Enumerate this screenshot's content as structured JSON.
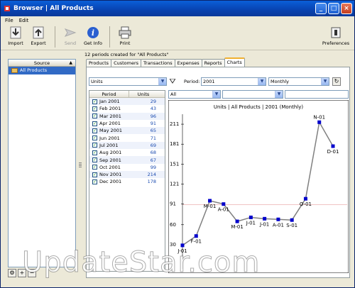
{
  "window": {
    "title": "Browser | All Products"
  },
  "menu": [
    "File",
    "Edit"
  ],
  "toolbar": {
    "import": "Import",
    "export": "Export",
    "send": "Send",
    "get_info": "Get Info",
    "print": "Print",
    "preferences": "Preferences"
  },
  "sidebar": {
    "header": "Source",
    "items": [
      {
        "label": "All Products"
      }
    ]
  },
  "status_text": "12 periods created for \"All Products\"",
  "tabs": [
    "Products",
    "Customers",
    "Transactions",
    "Expenses",
    "Reports",
    "Charts"
  ],
  "active_tab": "Charts",
  "controls": {
    "measure": "Units",
    "period_label": "Period:",
    "period_value": "2001",
    "interval": "Monthly",
    "filter1": "All",
    "filter2": "",
    "filter3": ""
  },
  "table": {
    "headers": [
      "Period",
      "Units"
    ],
    "rows": [
      {
        "period": "Jan 2001",
        "units": "29"
      },
      {
        "period": "Feb 2001",
        "units": "43"
      },
      {
        "period": "Mar 2001",
        "units": "96"
      },
      {
        "period": "Apr 2001",
        "units": "91"
      },
      {
        "period": "May 2001",
        "units": "65"
      },
      {
        "period": "Jun 2001",
        "units": "71"
      },
      {
        "period": "Jul 2001",
        "units": "69"
      },
      {
        "period": "Aug 2001",
        "units": "68"
      },
      {
        "period": "Sep 2001",
        "units": "67"
      },
      {
        "period": "Oct 2001",
        "units": "99"
      },
      {
        "period": "Nov 2001",
        "units": "214"
      },
      {
        "period": "Dec 2001",
        "units": "178"
      }
    ]
  },
  "chart_data": {
    "type": "line",
    "title": "Units | All Products | 2001 (Monthly)",
    "categories": [
      "J-01",
      "F-01",
      "M-01",
      "A-01",
      "M-01",
      "J-01",
      "J-01",
      "A-01",
      "S-01",
      "O-01",
      "N-01",
      "D-01"
    ],
    "values": [
      29,
      43,
      96,
      91,
      65,
      71,
      69,
      68,
      67,
      99,
      214,
      178
    ],
    "yticks": [
      30,
      60,
      91,
      121,
      151,
      181,
      211
    ],
    "ylim": [
      15,
      226
    ],
    "grid": false,
    "series_color": "#808080",
    "marker_color": "#0000cc"
  },
  "watermark": "UpdateStar.com",
  "colors": {
    "title_bar": "#0842b0",
    "selection": "#316ac5",
    "active_tab_accent": "#f0b030"
  }
}
